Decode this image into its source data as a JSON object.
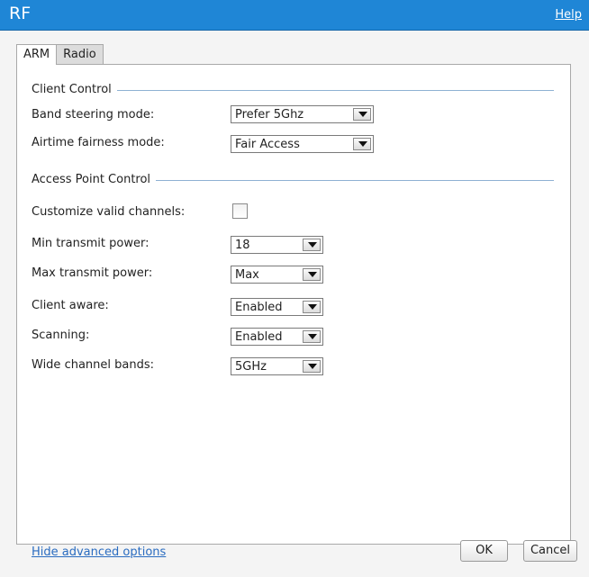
{
  "window": {
    "title": "RF",
    "help_label": "Help"
  },
  "tabs": [
    {
      "label": "ARM"
    },
    {
      "label": "Radio"
    }
  ],
  "client_control": {
    "legend": "Client Control",
    "band_steering": {
      "label": "Band steering mode:",
      "value": "Prefer 5Ghz"
    },
    "airtime_fairness": {
      "label": "Airtime fairness mode:",
      "value": "Fair Access"
    }
  },
  "ap_control": {
    "legend": "Access Point Control",
    "customize_channels": {
      "label": "Customize valid channels:",
      "checked": false
    },
    "min_power": {
      "label": "Min transmit power:",
      "value": "18"
    },
    "max_power": {
      "label": "Max transmit power:",
      "value": "Max"
    },
    "client_aware": {
      "label": "Client aware:",
      "value": "Enabled"
    },
    "scanning": {
      "label": "Scanning:",
      "value": "Enabled"
    },
    "wide_channel": {
      "label": "Wide channel bands:",
      "value": "5GHz"
    }
  },
  "footer": {
    "hide_advanced": "Hide advanced options",
    "ok_label": "OK",
    "cancel_label": "Cancel"
  }
}
